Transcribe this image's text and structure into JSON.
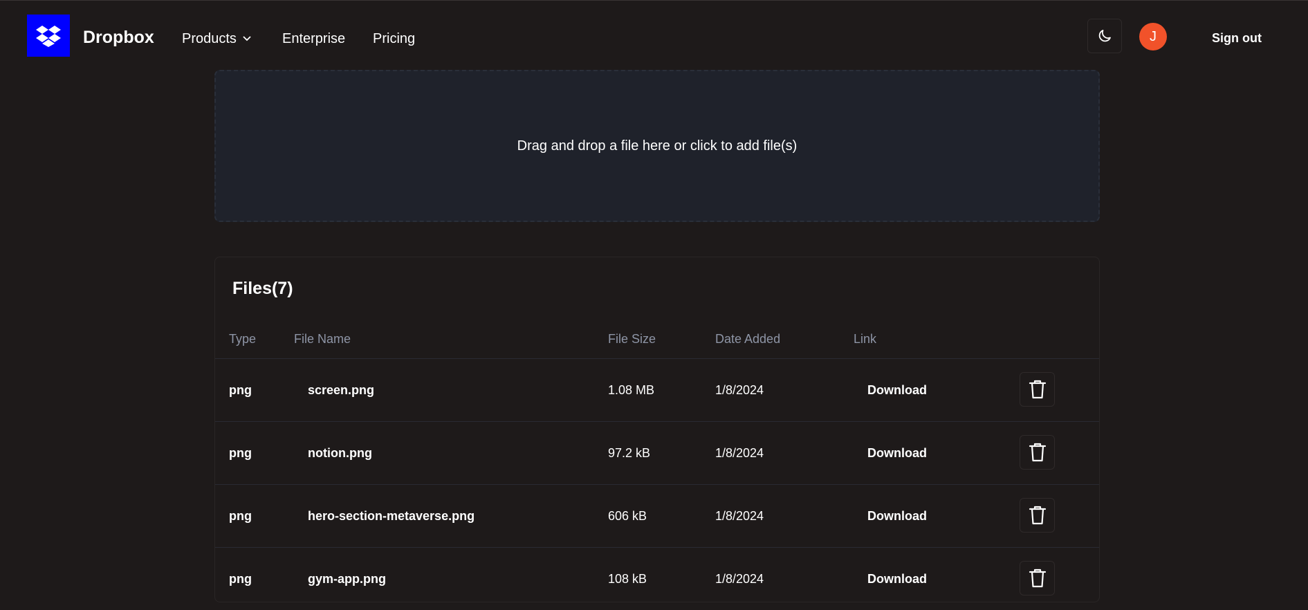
{
  "brand": {
    "name": "Dropbox",
    "logo_icon": "dropbox-logo-icon",
    "logo_color": "#0000ff"
  },
  "nav": {
    "products": "Products",
    "enterprise": "Enterprise",
    "pricing": "Pricing"
  },
  "header_right": {
    "theme_icon": "moon-icon",
    "avatar_initial": "J",
    "avatar_color": "#f1522a",
    "sign_out": "Sign out"
  },
  "dropzone": {
    "text": "Drag and drop a file here or click to add file(s)"
  },
  "files": {
    "title": "Files(7)",
    "columns": [
      "Type",
      "File Name",
      "File Size",
      "Date Added",
      "Link"
    ],
    "rows": [
      {
        "type": "png",
        "name": "screen.png",
        "size": "1.08 MB",
        "date": "1/8/2024",
        "link": "Download"
      },
      {
        "type": "png",
        "name": "notion.png",
        "size": "97.2 kB",
        "date": "1/8/2024",
        "link": "Download"
      },
      {
        "type": "png",
        "name": "hero-section-metaverse.png",
        "size": "606 kB",
        "date": "1/8/2024",
        "link": "Download"
      },
      {
        "type": "png",
        "name": "gym-app.png",
        "size": "108 kB",
        "date": "1/8/2024",
        "link": "Download"
      }
    ]
  }
}
